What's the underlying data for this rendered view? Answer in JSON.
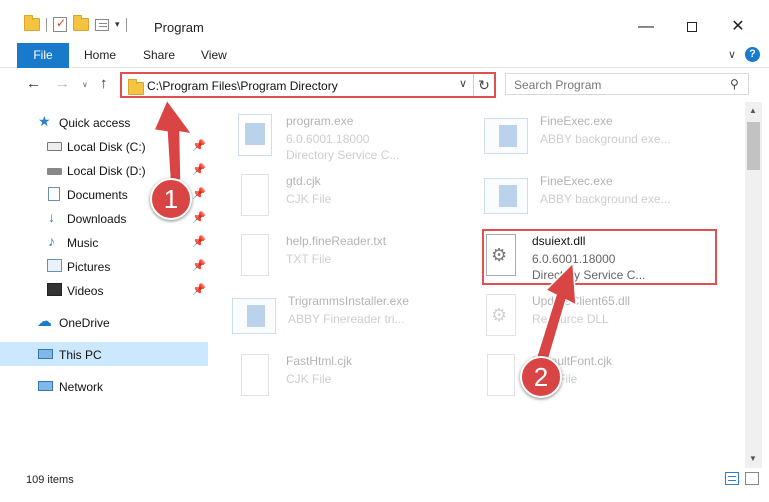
{
  "window": {
    "title": "Program",
    "minimize_glyph": "—",
    "close_glyph": "✕"
  },
  "quick_access_toolbar": {
    "dropdown_glyph": "▾"
  },
  "ribbon": {
    "tabs": [
      {
        "label": "File",
        "active": true
      },
      {
        "label": "Home"
      },
      {
        "label": "Share"
      },
      {
        "label": "View"
      }
    ],
    "expand_glyph": "∨",
    "help_glyph": "?"
  },
  "navigation": {
    "back_glyph": "←",
    "forward_glyph": "→",
    "recent_glyph": "∨",
    "up_glyph": "↑",
    "address": "C:\\Program Files\\Program Directory",
    "address_dropdown_glyph": "∨",
    "refresh_glyph": "↻",
    "search_placeholder": "Search Program",
    "search_glyph": "⚲"
  },
  "sidebar": {
    "pin_glyph": "📌",
    "items": [
      {
        "label": "Quick access",
        "icon": "star-icon",
        "pinned": false
      },
      {
        "label": "Local Disk (C:)",
        "icon": "disk-icon",
        "pinned": true
      },
      {
        "label": "Local Disk (D:)",
        "icon": "drive-icon",
        "pinned": true
      },
      {
        "label": "Documents",
        "icon": "documents-icon",
        "pinned": true
      },
      {
        "label": "Downloads",
        "icon": "download-icon",
        "pinned": true
      },
      {
        "label": "Music",
        "icon": "music-icon",
        "pinned": true
      },
      {
        "label": "Pictures",
        "icon": "pictures-icon",
        "pinned": true
      },
      {
        "label": "Videos",
        "icon": "videos-icon",
        "pinned": true
      },
      {
        "label": "OneDrive",
        "icon": "cloud-icon",
        "pinned": false
      },
      {
        "label": "This PC",
        "icon": "computer-icon",
        "pinned": false,
        "selected": true
      },
      {
        "label": "Network",
        "icon": "network-icon",
        "pinned": false
      }
    ]
  },
  "files": [
    {
      "name": "program.exe",
      "line1": "6.0.6001.18000",
      "line2": "Directory Service C...",
      "icon": "exe-icon",
      "faded": true
    },
    {
      "name": "FineExec.exe",
      "line1": "ABBY background exe...",
      "line2": "",
      "icon": "window-icon",
      "faded": true
    },
    {
      "name": "gtd.cjk",
      "line1": "CJK File",
      "line2": "",
      "icon": "page-icon",
      "faded": true
    },
    {
      "name": "FineExec.exe",
      "line1": "ABBY background exe...",
      "line2": "",
      "icon": "window-icon",
      "faded": true
    },
    {
      "name": "help.fineReader.txt",
      "line1": "TXT File",
      "line2": "",
      "icon": "page-icon",
      "faded": true
    },
    {
      "name": "dsuiext.dll",
      "line1": "6.0.6001.18000",
      "line2": "Directory Service C...",
      "icon": "dll-icon",
      "faded": false,
      "highlighted": true
    },
    {
      "name": "TrigrammsInstaller.exe",
      "line1": "ABBY Finereader tri...",
      "line2": "",
      "icon": "window-icon",
      "faded": true
    },
    {
      "name": "UpdateClient65.dll",
      "line1": "Resource DLL",
      "line2": "",
      "icon": "dll-icon",
      "faded": true
    },
    {
      "name": "FastHtml.cjk",
      "line1": "CJK File",
      "line2": "",
      "icon": "page-icon",
      "faded": true
    },
    {
      "name": "DefaultFont.cjk",
      "line1": "CJK File",
      "line2": "",
      "icon": "page-icon",
      "faded": true
    }
  ],
  "scrollbar": {
    "up_glyph": "▲",
    "down_glyph": "▼"
  },
  "status": {
    "item_count": "109 items"
  },
  "annotations": {
    "step1": "1",
    "step2": "2",
    "color": "#d94545"
  }
}
